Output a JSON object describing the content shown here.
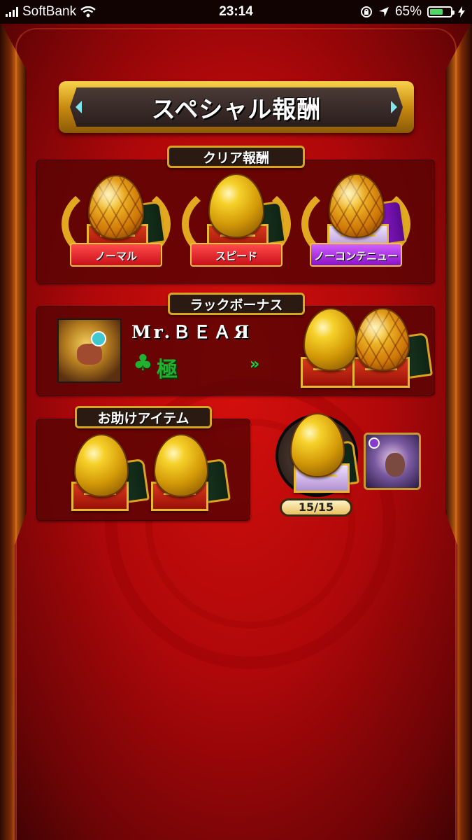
{
  "status_bar": {
    "carrier": "SoftBank",
    "time": "23:14",
    "battery_percent": "65%",
    "battery_level": 0.65
  },
  "title": "スペシャル報酬",
  "clear_rewards": {
    "label": "クリア報酬",
    "items": [
      {
        "ribbon": "ノーマル",
        "ribbon_color": "#e01828",
        "egg_type": "hex-egg"
      },
      {
        "ribbon": "スピード",
        "ribbon_color": "#e01828",
        "egg_type": "gold-egg"
      },
      {
        "ribbon": "ノーコンテニュー",
        "ribbon_color": "#a020e0",
        "egg_type": "hex-egg"
      }
    ]
  },
  "luck_bonus": {
    "label": "ラックボーナス",
    "player_name": "Mr.ＢＥＡЯ",
    "clover_symbol": "♣",
    "rank": "極",
    "arrows": "»"
  },
  "assist_items": {
    "label": "お助けアイテム"
  },
  "assist_counter": {
    "text": "15/15",
    "current": 15,
    "max": 15
  }
}
